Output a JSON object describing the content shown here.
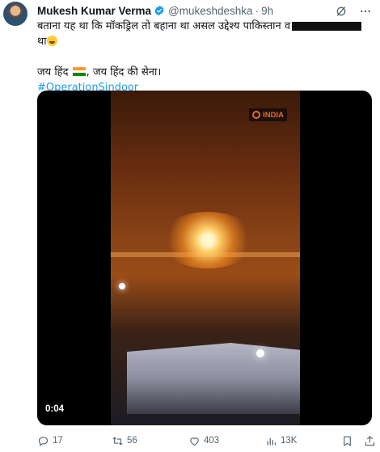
{
  "author": {
    "name": "Mukesh Kumar Verma",
    "handle": "@mukeshdeshka",
    "separator": "·",
    "time": "9h"
  },
  "tweet": {
    "line1": "बताना यह था कि मॉकड्रिल तो बहाना था असल उद्देश्य पाकिस्तान व",
    "line2": "था",
    "line3_a": "जय हिंद",
    "line3_b": ", जय हिंद की सेना।",
    "hashtag": "#OperationSindoor"
  },
  "media": {
    "watermark": "INDIA",
    "timestamp": "0:04"
  },
  "actions": {
    "replies": "17",
    "retweets": "56",
    "likes": "403",
    "views": "13K"
  },
  "icons": {
    "verified": "verified-badge-icon",
    "grok": "grok-icon",
    "more": "more-icon",
    "reply": "reply-icon",
    "retweet": "retweet-icon",
    "like": "heart-icon",
    "views": "views-icon",
    "bookmark": "bookmark-icon",
    "share": "share-icon"
  },
  "colors": {
    "accent": "#1d9bf0",
    "muted": "#536471",
    "text": "#0f1419"
  }
}
